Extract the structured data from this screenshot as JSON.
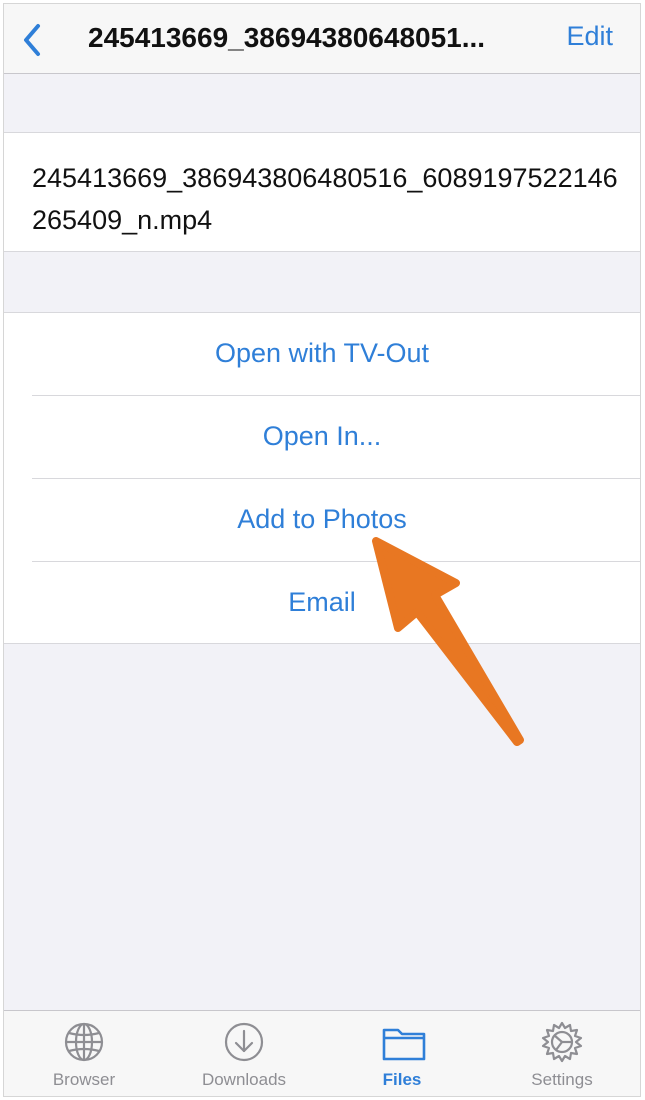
{
  "navbar": {
    "back_icon": "chevron-left-icon",
    "title": "245413669_38694380648051...",
    "edit_label": "Edit"
  },
  "file": {
    "name": "245413669_386943806480516_6089197522146265409_n.mp4"
  },
  "actions": [
    {
      "label": "Open with TV-Out"
    },
    {
      "label": "Open In..."
    },
    {
      "label": "Add to Photos"
    },
    {
      "label": "Email"
    }
  ],
  "tabbar": {
    "tabs": [
      {
        "label": "Browser",
        "icon": "globe-icon",
        "active": false
      },
      {
        "label": "Downloads",
        "icon": "download-circle-icon",
        "active": false
      },
      {
        "label": "Files",
        "icon": "folder-icon",
        "active": true
      },
      {
        "label": "Settings",
        "icon": "gear-icon",
        "active": false
      }
    ]
  },
  "colors": {
    "accent": "#2f7fd8",
    "annotation_arrow": "#e87722",
    "background": "#f2f2f7",
    "inactive_tab": "#8e8e93"
  },
  "annotation": {
    "arrow_icon": "pointer-arrow-icon",
    "points_to": "Add to Photos"
  }
}
